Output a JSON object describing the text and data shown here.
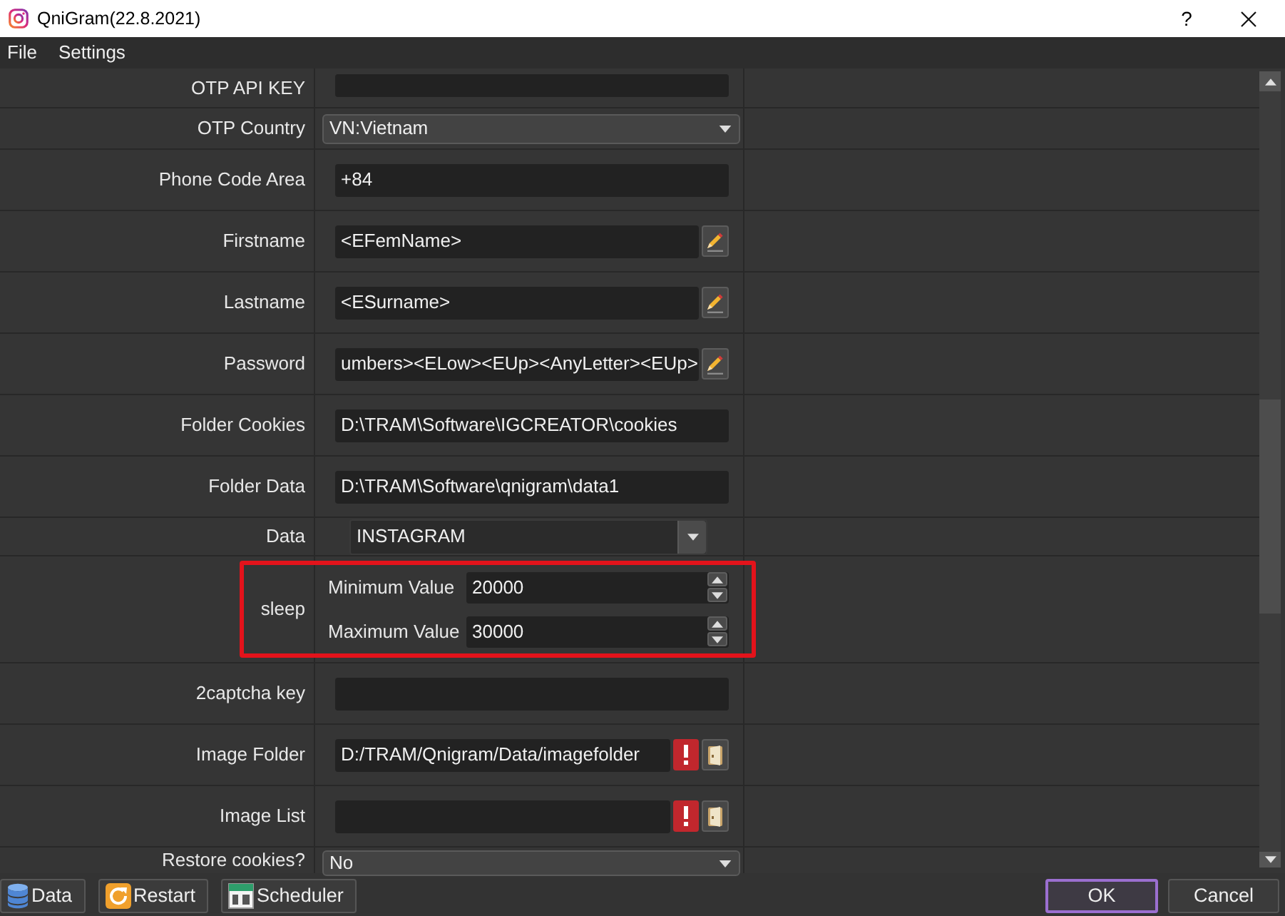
{
  "window": {
    "title": "QniGram(22.8.2021)",
    "help": "?"
  },
  "menu": [
    {
      "label": "File"
    },
    {
      "label": "Settings"
    }
  ],
  "properties": [
    {
      "kind": "input",
      "label": "OTP API KEY"
    },
    {
      "kind": "select",
      "label": "OTP Country",
      "value": "VN:Vietnam"
    },
    {
      "kind": "input",
      "label": "Phone Code Area",
      "value": "+84"
    },
    {
      "kind": "pattern",
      "label": "Firstname",
      "value": "<EFemName>"
    },
    {
      "kind": "pattern",
      "label": "Lastname",
      "value": "<ESurname>"
    },
    {
      "kind": "pattern",
      "label": "Password",
      "value": "umbers><ELow><EUp><AnyLetter><EUp>"
    },
    {
      "kind": "input",
      "label": "Folder Cookies",
      "value": "D:\\TRAM\\Software\\IGCREATOR\\cookies"
    },
    {
      "kind": "input",
      "label": "Folder Data",
      "value": "D:\\TRAM\\Software\\qnigram\\data1"
    },
    {
      "kind": "combo",
      "label": "Data",
      "value": "INSTAGRAM"
    },
    {
      "kind": "range",
      "label": "sleep",
      "highlighted": true,
      "fields": [
        {
          "label": "Minimum Value",
          "value": "20000"
        },
        {
          "label": "Maximum Value",
          "value": "30000"
        }
      ]
    },
    {
      "kind": "input",
      "label": "2captcha key"
    },
    {
      "kind": "path",
      "label": "Image Folder",
      "value": "D:/TRAM/Qnigram/Data/imagefolder",
      "invalid": true
    },
    {
      "kind": "path",
      "label": "Image List",
      "invalid": true
    },
    {
      "kind": "select",
      "label": "Restore cookies?",
      "value": "No"
    }
  ],
  "footer": {
    "left": [
      {
        "kind": "database",
        "label": "Data"
      },
      {
        "kind": "restart",
        "label": "Restart"
      },
      {
        "kind": "calendar",
        "label": "Scheduler"
      }
    ],
    "right": [
      {
        "label": "OK",
        "focused": true
      },
      {
        "label": "Cancel",
        "focused": false
      }
    ]
  }
}
